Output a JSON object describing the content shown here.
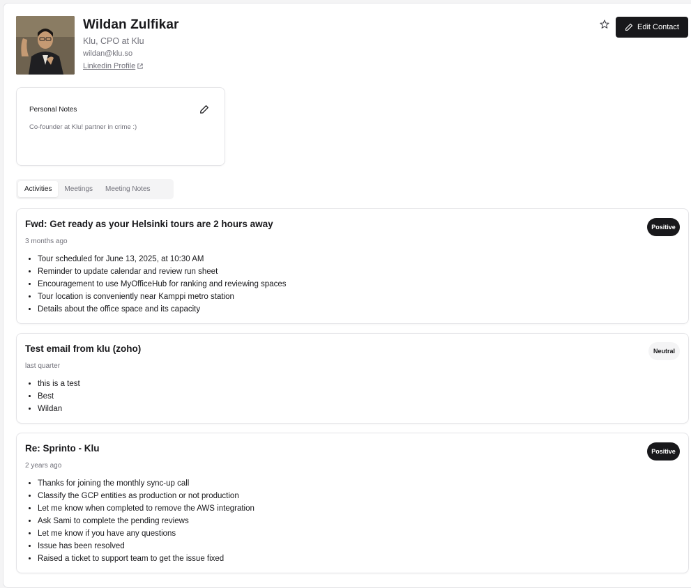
{
  "contact": {
    "name": "Wildan Zulfikar",
    "role": "Klu, CPO at Klu",
    "email": "wildan@klu.so",
    "linkedin_label": "Linkedin Profile"
  },
  "header_actions": {
    "favorite_icon": "star-icon",
    "edit_label": "Edit Contact"
  },
  "notes": {
    "title": "Personal Notes",
    "body": "Co-founder at Klu! partner in crime :)"
  },
  "tabs": [
    {
      "label": "Activities",
      "active": true
    },
    {
      "label": "Meetings",
      "active": false
    },
    {
      "label": "Meeting Notes",
      "active": false
    }
  ],
  "activities": [
    {
      "title": "Fwd: Get ready as your Helsinki tours are 2 hours away",
      "time": "3 months ago",
      "sentiment": "Positive",
      "bullets": [
        "Tour scheduled for June 13, 2025, at 10:30 AM",
        "Reminder to update calendar and review run sheet",
        "Encouragement to use MyOfficeHub for ranking and reviewing spaces",
        "Tour location is conveniently near Kamppi metro station",
        "Details about the office space and its capacity"
      ]
    },
    {
      "title": "Test email from klu (zoho)",
      "time": "last quarter",
      "sentiment": "Neutral",
      "bullets": [
        "this is a test",
        "Best",
        "Wildan"
      ]
    },
    {
      "title": "Re: Sprinto - Klu",
      "time": "2 years ago",
      "sentiment": "Positive",
      "bullets": [
        "Thanks for joining the monthly sync-up call",
        "Classify the GCP entities as production or not production",
        "Let me know when completed to remove the AWS integration",
        "Ask Sami to complete the pending reviews",
        "Let me know if you have any questions",
        "Issue has been resolved",
        "Raised a ticket to support team to get the issue fixed"
      ]
    }
  ],
  "colors": {
    "primary": "#18181b",
    "muted_text": "#71717a",
    "border": "#e4e4e7",
    "neutral_badge": "#f4f4f5"
  }
}
